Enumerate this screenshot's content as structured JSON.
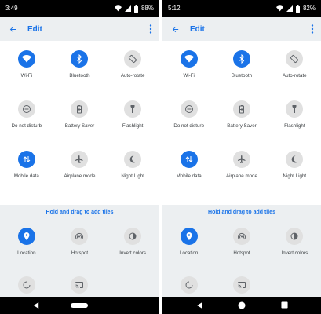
{
  "screens": [
    {
      "status": {
        "time": "3:49",
        "battery": "88%"
      },
      "header": {
        "title": "Edit"
      },
      "active_tiles": [
        {
          "label": "Wi-Fi",
          "icon": "wifi-icon",
          "state": "on"
        },
        {
          "label": "Bluetooth",
          "icon": "bluetooth-icon",
          "state": "on"
        },
        {
          "label": "Auto-rotate",
          "icon": "auto-rotate-icon",
          "state": "off"
        },
        {
          "label": "Do not disturb",
          "icon": "do-not-disturb-icon",
          "state": "off"
        },
        {
          "label": "Battery Saver",
          "icon": "battery-saver-icon",
          "state": "off"
        },
        {
          "label": "Flashlight",
          "icon": "flashlight-icon",
          "state": "off"
        },
        {
          "label": "Mobile data",
          "icon": "mobile-data-icon",
          "state": "on"
        },
        {
          "label": "Airplane mode",
          "icon": "airplane-icon",
          "state": "off"
        },
        {
          "label": "Night Light",
          "icon": "night-light-icon",
          "state": "off"
        }
      ],
      "hint": "Hold and drag to add tiles",
      "available_tiles": [
        {
          "label": "Location",
          "icon": "location-icon",
          "state": "on"
        },
        {
          "label": "Hotspot",
          "icon": "hotspot-icon",
          "state": "off"
        },
        {
          "label": "Invert colors",
          "icon": "invert-colors-icon",
          "state": "off"
        },
        {
          "label": "",
          "icon": "data-saver-icon",
          "state": "off"
        },
        {
          "label": "",
          "icon": "cast-icon",
          "state": "off"
        }
      ],
      "nav": {
        "style": "gesture"
      }
    },
    {
      "status": {
        "time": "5:12",
        "battery": "82%"
      },
      "header": {
        "title": "Edit"
      },
      "active_tiles": [
        {
          "label": "Wi-Fi",
          "icon": "wifi-icon",
          "state": "on"
        },
        {
          "label": "Bluetooth",
          "icon": "bluetooth-icon",
          "state": "on"
        },
        {
          "label": "Auto-rotate",
          "icon": "auto-rotate-icon",
          "state": "off"
        },
        {
          "label": "Do not disturb",
          "icon": "do-not-disturb-icon",
          "state": "off"
        },
        {
          "label": "Battery Saver",
          "icon": "battery-saver-icon",
          "state": "off"
        },
        {
          "label": "Flashlight",
          "icon": "flashlight-icon",
          "state": "off"
        },
        {
          "label": "Mobile data",
          "icon": "mobile-data-icon",
          "state": "on"
        },
        {
          "label": "Airplane mode",
          "icon": "airplane-icon",
          "state": "off"
        },
        {
          "label": "Night Light",
          "icon": "night-light-icon",
          "state": "off"
        }
      ],
      "hint": "Hold and drag to add tiles",
      "available_tiles": [
        {
          "label": "Location",
          "icon": "location-icon",
          "state": "on"
        },
        {
          "label": "Hotspot",
          "icon": "hotspot-icon",
          "state": "off"
        },
        {
          "label": "Invert colors",
          "icon": "invert-colors-icon",
          "state": "off"
        },
        {
          "label": "",
          "icon": "data-saver-icon",
          "state": "off"
        },
        {
          "label": "",
          "icon": "cast-icon",
          "state": "off"
        }
      ],
      "nav": {
        "style": "buttons"
      }
    }
  ],
  "colors": {
    "accent": "#1a73e8",
    "tile_off": "#e0e0e0",
    "panel_background": "#eceff1",
    "label_text": "#3c4043"
  }
}
